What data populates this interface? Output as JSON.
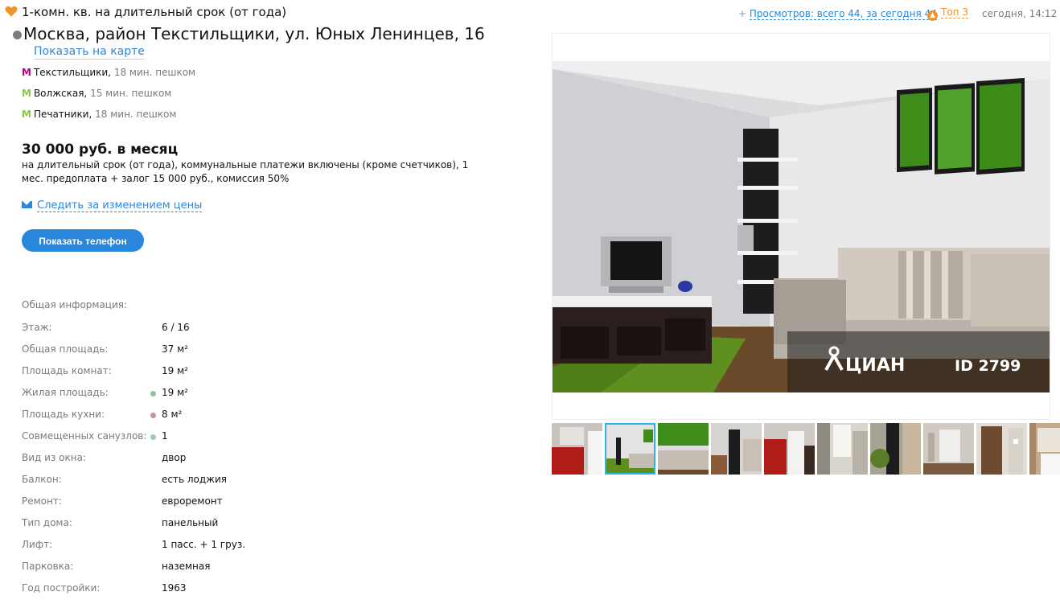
{
  "header": {
    "offer_title": "1-комн. кв. на длительный срок (от года)",
    "views_prefix": "+",
    "views_text": "Просмотров: всего 44, за сегодня 44",
    "top_label": "Топ 3",
    "timestamp": "сегодня, 14:12"
  },
  "address": {
    "text": "Москва, район Текстильщики, ул. Юных Ленинцев, 16",
    "map_link": "Показать на карте"
  },
  "metro": [
    {
      "name": "Текстильщики,",
      "walk": "18 мин. пешком",
      "color": "#b5007c"
    },
    {
      "name": "Волжская,",
      "walk": "15 мин. пешком",
      "color": "#8cc63f"
    },
    {
      "name": "Печатники,",
      "walk": "18 мин. пешком",
      "color": "#8cc63f"
    }
  ],
  "price": {
    "amount": "30 000 руб. в месяц",
    "terms": "на длительный срок (от года), коммунальные платежи включены (кроме счетчиков), 1 мес. предоплата + залог 15 000 руб., комиссия 50%"
  },
  "watch_price_label": "Следить за изменением цены",
  "show_phone_label": "Показать телефон",
  "info": {
    "title": "Общая информация:",
    "rows": [
      {
        "label": "Этаж:",
        "value": "6 / 16"
      },
      {
        "label": "Общая площадь:",
        "value": "37 м²"
      },
      {
        "label": "Площадь комнат:",
        "value": "19 м²"
      },
      {
        "label": "Жилая площадь:",
        "value": "19 м²",
        "dot": "#8bc59a"
      },
      {
        "label": "Площадь кухни:",
        "value": "8 м²",
        "dot": "#c99592"
      },
      {
        "label": "Совмещенных санузлов:",
        "value": "1",
        "dot": "#97c8cf"
      },
      {
        "label": "Вид из окна:",
        "value": "двор"
      },
      {
        "label": "Балкон:",
        "value": "есть лоджия"
      },
      {
        "label": "Ремонт:",
        "value": "евроремонт"
      },
      {
        "label": "Тип дома:",
        "value": "панельный"
      },
      {
        "label": "Лифт:",
        "value": "1 пасс. + 1 груз."
      },
      {
        "label": "Парковка:",
        "value": "наземная"
      },
      {
        "label": "Год постройки:",
        "value": "1963"
      }
    ]
  },
  "gallery": {
    "watermark_brand": "ЦИАН",
    "watermark_id": "ID 2799",
    "thumb_count": 9,
    "active_thumb": 1
  },
  "colors": {
    "link": "#2b87db",
    "button": "#2b87db",
    "favorite": "#f0932b"
  }
}
